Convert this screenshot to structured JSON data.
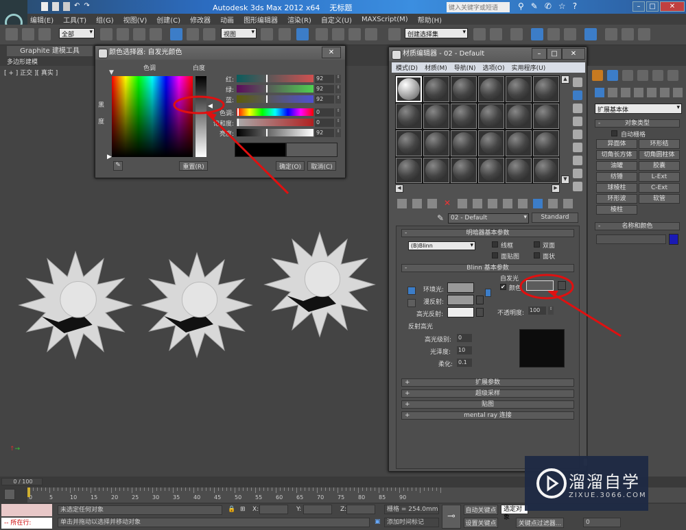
{
  "app": {
    "title": "Autodesk 3ds Max  2012 x64",
    "doc": "无标题",
    "search_placeholder": "键入关键字或短语"
  },
  "menu": [
    "编辑(E)",
    "工具(T)",
    "组(G)",
    "视图(V)",
    "创建(C)",
    "修改器",
    "动画",
    "图形编辑器",
    "渲染(R)",
    "自定义(U)",
    "MAXScript(M)",
    "帮助(H)"
  ],
  "toolbar": {
    "selection_filter": "全部",
    "ref_coord": "视图",
    "named_selection": "创建选择集"
  },
  "ribbon": {
    "tab": "Graphite 建模工具",
    "sub": "多边形建模"
  },
  "viewport": {
    "label": "[ + ] 正交 ][ 真实 ]"
  },
  "color_picker": {
    "title": "颜色选择器: 自发光颜色",
    "hue_label": "色调",
    "white_label": "白度",
    "black_label": "黑度",
    "channels": [
      {
        "label": "红:",
        "value": "92"
      },
      {
        "label": "绿:",
        "value": "92"
      },
      {
        "label": "蓝:",
        "value": "92"
      },
      {
        "label": "色调:",
        "value": "0"
      },
      {
        "label": "饱和度:",
        "value": "0"
      },
      {
        "label": "亮度:",
        "value": "92"
      }
    ],
    "reset": "重置(R)",
    "ok": "确定(O)",
    "cancel": "取消(C)",
    "old_color": "#000000",
    "new_color": "#5c5c5c"
  },
  "material_editor": {
    "title": "材质编辑器 - 02 - Default",
    "menu": [
      "模式(D)",
      "材质(M)",
      "导航(N)",
      "选项(O)",
      "实用程序(U)"
    ],
    "material_name": "02 - Default",
    "material_type": "Standard",
    "shader_rollout": "明暗器基本参数",
    "shader": "(B)Blinn",
    "shader_options": [
      "线框",
      "双面",
      "面贴图",
      "面状"
    ],
    "blinn_rollout": "Blinn 基本参数",
    "self_illum": "自发光",
    "color_label": "颜色",
    "color_checked": true,
    "ambient": "环境光:",
    "diffuse": "漫反射:",
    "specular": "高光反射:",
    "opacity_label": "不透明度:",
    "opacity": "100",
    "spec_group": "反射高光",
    "spec_level_label": "高光级别:",
    "spec_level": "0",
    "gloss_label": "光泽度:",
    "gloss": "10",
    "soften_label": "柔化:",
    "soften": "0.1",
    "rollouts": [
      "扩展参数",
      "超级采样",
      "贴图",
      "mental ray 连接"
    ]
  },
  "command_panel": {
    "category": "扩展基本体",
    "object_type": "对象类型",
    "autogrid": "自动栅格",
    "buttons": [
      "异面体",
      "环形结",
      "切角长方体",
      "切角圆柱体",
      "油罐",
      "胶囊",
      "纺锤",
      "L-Ext",
      "球棱柱",
      "C-Ext",
      "环形波",
      "软管",
      "棱柱"
    ],
    "name_color": "名称和颜色",
    "object_color": "#1a1ab4"
  },
  "timeline": {
    "frame": "0 / 100",
    "ticks": [
      "0",
      "5",
      "10",
      "15",
      "20",
      "25",
      "30",
      "35",
      "40",
      "45",
      "50",
      "55",
      "60",
      "65",
      "70",
      "75",
      "80",
      "85",
      "90"
    ]
  },
  "status": {
    "selection": "未选定任何对象",
    "prompt": "单击并拖动以选择并移动对象",
    "x": "X:",
    "y": "Y:",
    "z": "Z:",
    "grid": "栅格 = 254.0mm",
    "add_time_tag": "添加时间标记",
    "auto_key": "自动关键点",
    "set_key": "设置关键点",
    "key_mode": "选定对象",
    "key_filters": "关键点过滤器...",
    "frame_value": "0",
    "script_label": "所在行:"
  },
  "watermark": {
    "name": "溜溜自学",
    "url": "ZIXUE.3066.COM"
  },
  "annotation_color": "#e01010"
}
